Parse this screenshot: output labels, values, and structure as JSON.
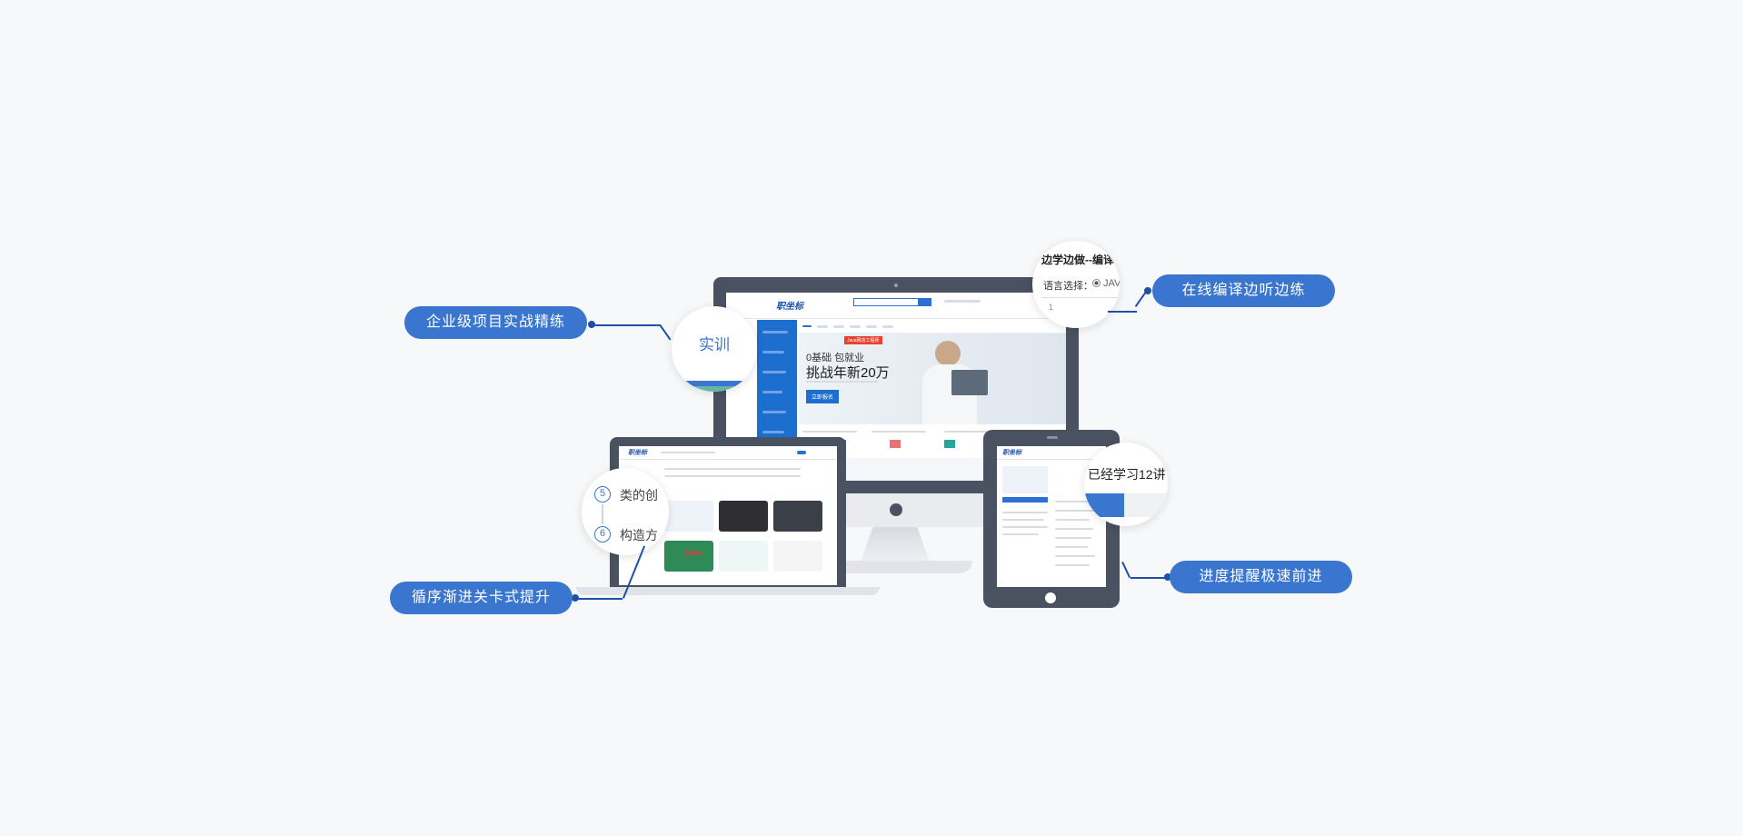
{
  "callouts": {
    "left_top": "企业级项目实战精练",
    "right_top": "在线编译边听边练",
    "left_bottom": "循序渐进关卡式提升",
    "right_bottom": "进度提醒极速前进"
  },
  "bubbles": {
    "practice": "实训",
    "compile_title": "边学边做--编译",
    "compile_lang_label": "语言选择：",
    "compile_lang_value": "JAV",
    "compile_line": "1",
    "progress": "已经学习12讲",
    "lesson_5_num": "5",
    "lesson_5_text": "类的创",
    "lesson_6_num": "6",
    "lesson_6_text": "构造方"
  },
  "monitor": {
    "logo": "职坐标",
    "banner_tag": "Java网店工程师",
    "banner_line1": "0基础 包就业",
    "banner_line2": "挑战年新20万",
    "banner_button": "立即报名"
  },
  "laptop": {
    "logo": "职坐标",
    "card_label": "Java"
  },
  "tablet": {
    "logo": "职坐标"
  },
  "colors": {
    "accent": "#3a76cf",
    "line": "#1e50a8",
    "device": "#4a5160"
  }
}
